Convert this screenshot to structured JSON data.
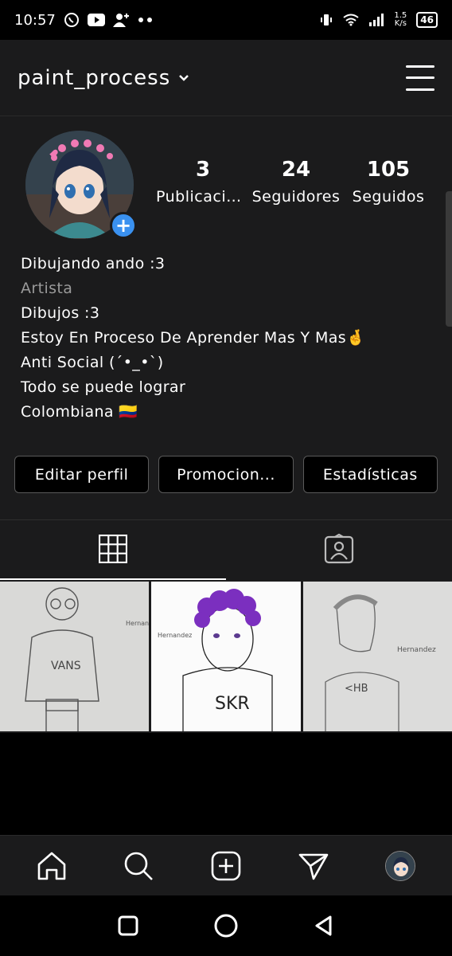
{
  "status_bar": {
    "time": "10:57",
    "speed_value": "1.5",
    "speed_unit": "K/s",
    "battery": "46",
    "left_icons": [
      "whatsapp-icon",
      "youtube-icon",
      "add-person-icon",
      "more-dots-icon"
    ],
    "right_icons": [
      "vibrate-icon",
      "wifi-icon",
      "signal-icon",
      "battery-icon"
    ]
  },
  "header": {
    "username": "paint_process",
    "dropdown_icon": "chevron-down-icon",
    "menu_icon": "hamburger-menu-icon"
  },
  "profile": {
    "avatar_icon": "profile-avatar",
    "add_story_icon": "plus-icon",
    "stats": [
      {
        "value": "3",
        "label": "Publicaciones"
      },
      {
        "value": "24",
        "label": "Seguidores"
      },
      {
        "value": "105",
        "label": "Seguidos"
      }
    ],
    "name": "Dibujando ando :3",
    "category": "Artista",
    "bio_lines": [
      "Dibujos :3",
      "Estoy En Proceso De Aprender Mas Y Mas🤞",
      "Anti Social (´•_•`)",
      "Todo se puede lograr",
      "Colombiana 🇨🇴"
    ]
  },
  "actions": {
    "edit": "Editar perfil",
    "promote": "Promocion...",
    "insights": "Estadísticas"
  },
  "tabs": [
    {
      "name": "grid",
      "icon": "grid-icon",
      "active": true
    },
    {
      "name": "tagged",
      "icon": "tagged-person-icon",
      "active": false
    }
  ],
  "posts": [
    {
      "caption": "VANS",
      "signature": "Hernandez"
    },
    {
      "caption": "SKR",
      "signature": "Hernandez"
    },
    {
      "caption": "<HB",
      "signature": "Hernandez"
    }
  ],
  "bottom_nav": [
    "home-icon",
    "search-icon",
    "add-post-icon",
    "activity-send-icon",
    "profile-avatar"
  ],
  "system_nav": [
    "recents-square-icon",
    "home-circle-icon",
    "back-triangle-icon"
  ],
  "colors": {
    "background": "#1b1b1c",
    "accent_blue": "#3a91f0",
    "muted_text": "#9a9a9a",
    "button_border": "#5a5a5a"
  }
}
